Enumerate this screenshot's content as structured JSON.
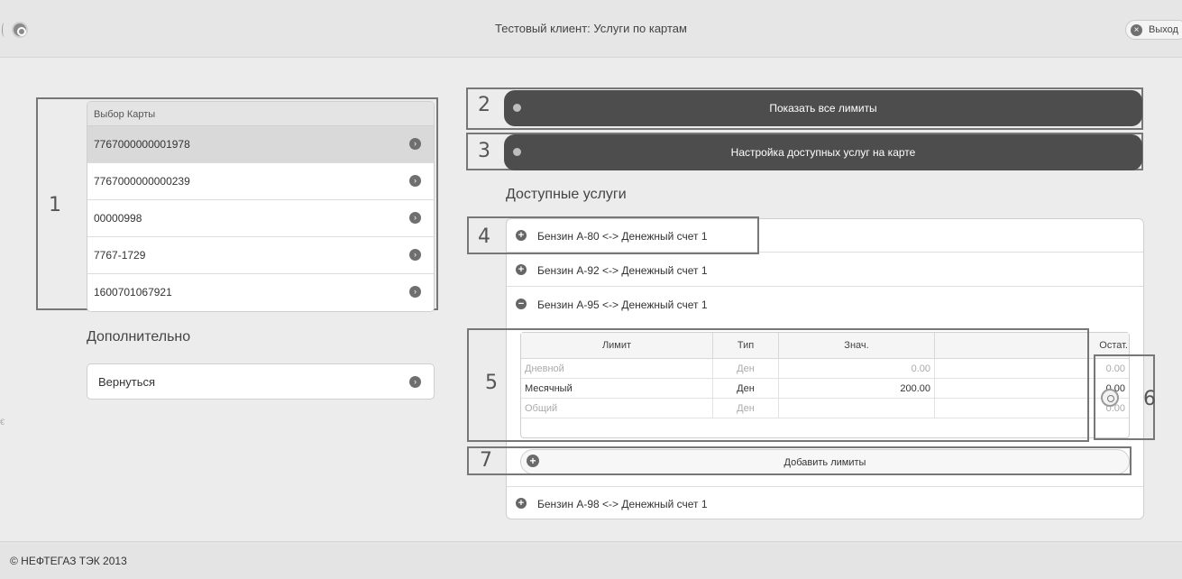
{
  "header": {
    "title": "Тестовый клиент: Услуги по картам",
    "logout_label": "Выход"
  },
  "cards": {
    "header": "Выбор Карты",
    "items": [
      "7767000000001978",
      "7767000000000239",
      "00000998",
      "7767-1729",
      "1600701067921"
    ],
    "selected_index": 0
  },
  "extra": {
    "heading": "Дополнительно",
    "back_label": "Вернуться"
  },
  "actions": {
    "show_limits": "Показать все лимиты",
    "configure_services": "Настройка доступных услуг на карте"
  },
  "services": {
    "heading": "Доступные услуги",
    "items": [
      {
        "label": "Бензин А-80 <-> Денежный счет 1",
        "state": "collapsed"
      },
      {
        "label": "Бензин А-92 <-> Денежный счет 1",
        "state": "collapsed"
      },
      {
        "label": "Бензин А-95 <-> Денежный счет 1",
        "state": "expanded"
      },
      {
        "label": "Бензин А-98 <-> Денежный счет 1",
        "state": "collapsed"
      }
    ]
  },
  "limits": {
    "columns": [
      "Лимит",
      "Тип",
      "Знач.",
      "Остат."
    ],
    "rows": [
      {
        "name": "Дневной",
        "type": "Ден",
        "value": "0.00",
        "rest": "0.00",
        "dim": true
      },
      {
        "name": "Месячный",
        "type": "Ден",
        "value": "200.00",
        "rest": "0.00",
        "dim": false
      },
      {
        "name": "Общий",
        "type": "Ден",
        "value": "",
        "rest": "0.00",
        "dim": true
      }
    ],
    "add_label": "Добавить лимиты"
  },
  "annotations": [
    "1",
    "2",
    "3",
    "4",
    "5",
    "6",
    "7"
  ],
  "footer": {
    "copyright": "© НЕФТЕГАЗ ТЭК 2013"
  },
  "colors": {
    "dark_button": "#4d4d4d",
    "background": "#ececec",
    "frame": "#777777"
  }
}
